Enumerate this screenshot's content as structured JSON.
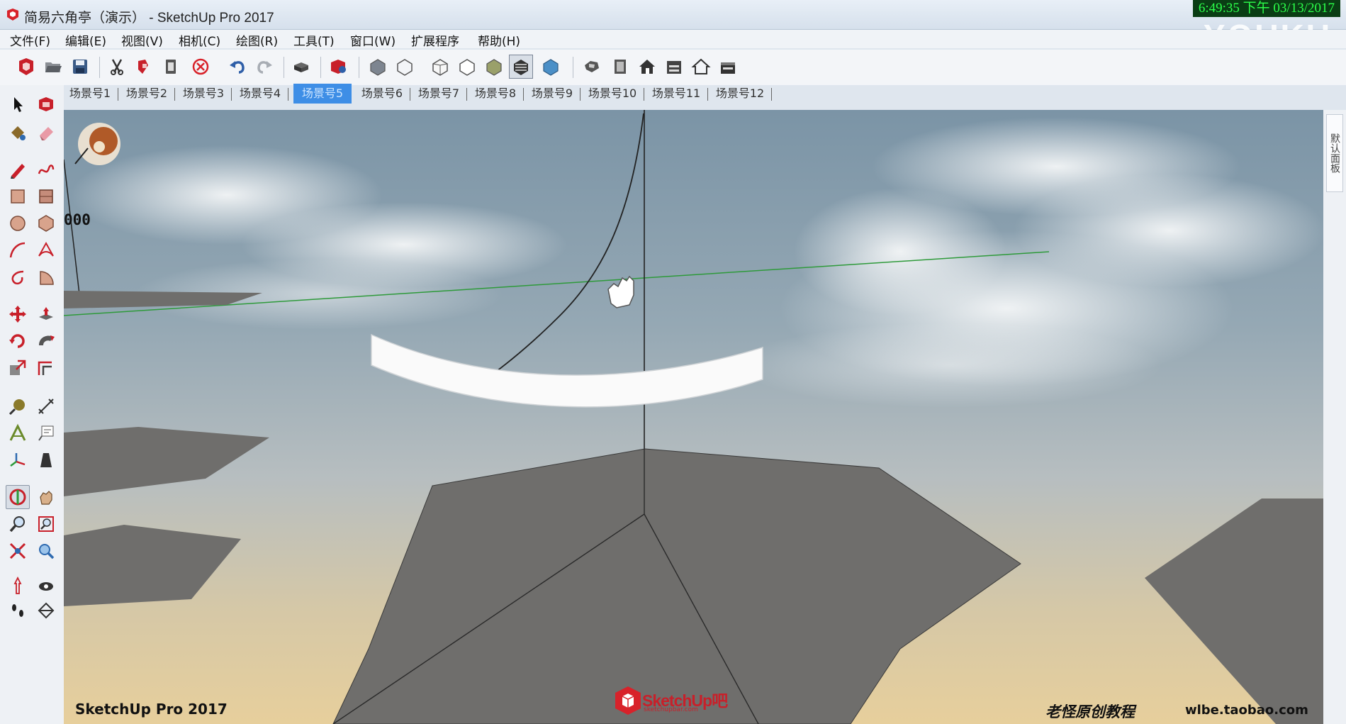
{
  "window": {
    "title": "简易六角亭（演示） - SketchUp Pro 2017",
    "clock": "6:49:35 下午 03/13/2017",
    "watermark": "YOUKU"
  },
  "menu": {
    "items": [
      "文件(F)",
      "编辑(E)",
      "视图(V)",
      "相机(C)",
      "绘图(R)",
      "工具(T)",
      "窗口(W)",
      "扩展程序",
      "帮助(H)"
    ]
  },
  "toolbar": {
    "buttons": [
      "sketchup-logo-icon",
      "open-folder-icon",
      "save-icon",
      "cut-icon",
      "copy-paint-icon",
      "paste-icon",
      "erase-circle-icon",
      "undo-icon",
      "redo-icon",
      "print-icon",
      "model-info-icon",
      "xray-style-icon",
      "wireframe-style-icon",
      "hidden-line-style-icon",
      "hidden-line-style-icon",
      "shaded-style-icon",
      "shaded-texture-style-icon",
      "monochrome-style-icon",
      "iso-view-icon",
      "top-view-icon",
      "front-view-icon",
      "right-view-icon",
      "back-view-icon",
      "left-view-icon"
    ]
  },
  "scenes": {
    "tabs": [
      "场景号1",
      "场景号2",
      "场景号3",
      "场景号4",
      "场景号5",
      "场景号6",
      "场景号7",
      "场景号8",
      "场景号9",
      "场景号10",
      "场景号11",
      "场景号12"
    ],
    "active_index": 4
  },
  "viewport": {
    "measurement_label": "000",
    "bottom_left_label": "SketchUp Pro 2017",
    "bottom_right_label_cn": "老怪原创教程",
    "bottom_right_label_url": "wlbe.taobao.com",
    "center_logo": "SketchUp吧",
    "center_logo_sub": "sketchupbar.com"
  },
  "side_panel": {
    "tab_label": "默认面板"
  },
  "colors": {
    "accent_tab": "#3e8ee6",
    "green_axis": "#2e9a3a",
    "surface_gray": "#6f6e6c",
    "clock_green": "#2cff4a"
  }
}
